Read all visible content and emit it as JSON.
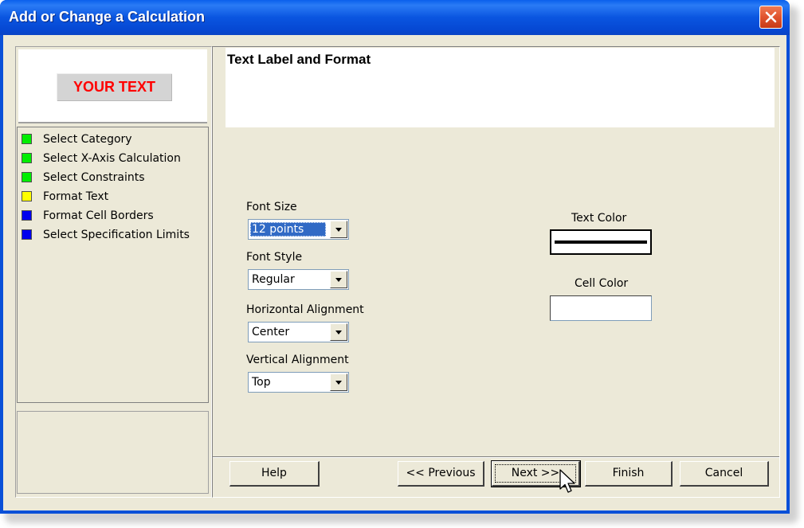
{
  "window": {
    "title": "Add or Change a Calculation"
  },
  "preview": {
    "text": "YOUR TEXT"
  },
  "steps": [
    {
      "label": "Select Category",
      "color": "#00ee00"
    },
    {
      "label": "Select X-Axis Calculation",
      "color": "#00ee00"
    },
    {
      "label": "Select Constraints",
      "color": "#00ee00"
    },
    {
      "label": "Format Text",
      "color": "#ffff00"
    },
    {
      "label": "Format Cell Borders",
      "color": "#0000ee"
    },
    {
      "label": "Select Specification Limits",
      "color": "#0000ee"
    }
  ],
  "header": {
    "title": "Text Label and Format"
  },
  "form": {
    "font_size": {
      "label": "Font Size",
      "value": "12 points"
    },
    "font_style": {
      "label": "Font Style",
      "value": "Regular"
    },
    "horizontal_alignment": {
      "label": "Horizontal Alignment",
      "value": "Center"
    },
    "vertical_alignment": {
      "label": "Vertical Alignment",
      "value": "Top"
    },
    "text_color": {
      "label": "Text Color",
      "value": "#000000"
    },
    "cell_color": {
      "label": "Cell Color",
      "value": "#ffffff"
    }
  },
  "buttons": {
    "help": "Help",
    "previous": "<< Previous",
    "next": "Next >>",
    "finish": "Finish",
    "cancel": "Cancel"
  }
}
